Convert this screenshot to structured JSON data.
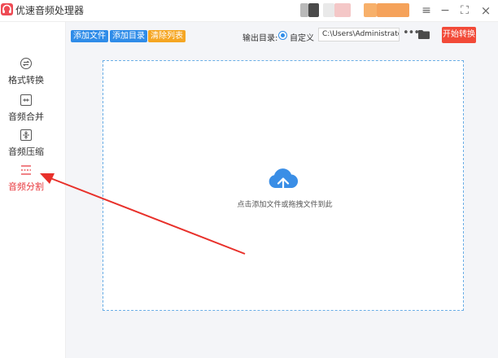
{
  "window": {
    "title": "优速音频处理器",
    "controls": {
      "menu_icon": "≡",
      "minimize_icon": "−",
      "maximize_icon": "⛶",
      "close_icon": "×"
    }
  },
  "sidebar": {
    "items": [
      {
        "label": "格式转换",
        "icon": "format-convert-icon",
        "active": false
      },
      {
        "label": "音频合并",
        "icon": "merge-icon",
        "active": false
      },
      {
        "label": "音频压缩",
        "icon": "compress-icon",
        "active": false
      },
      {
        "label": "音频分割",
        "icon": "split-icon",
        "active": true
      }
    ]
  },
  "toolbar": {
    "add_file": "添加文件",
    "add_dir": "添加目录",
    "clear_list": "清除列表",
    "output_label": "输出目录:",
    "output_option": "自定义",
    "output_path": "C:\\Users\\Administrator\\",
    "browse_dots": "•••",
    "start_button": "开始转换"
  },
  "dropzone": {
    "hint": "点击添加文件或拖拽文件到此"
  },
  "colors": {
    "brand_red": "#e8383d",
    "primary_blue": "#2f8ce8",
    "clear_orange": "#f5a623",
    "start_red": "#f24a38",
    "dropzone_border": "#6aaee6",
    "annotation_arrow": "#e8302a"
  }
}
